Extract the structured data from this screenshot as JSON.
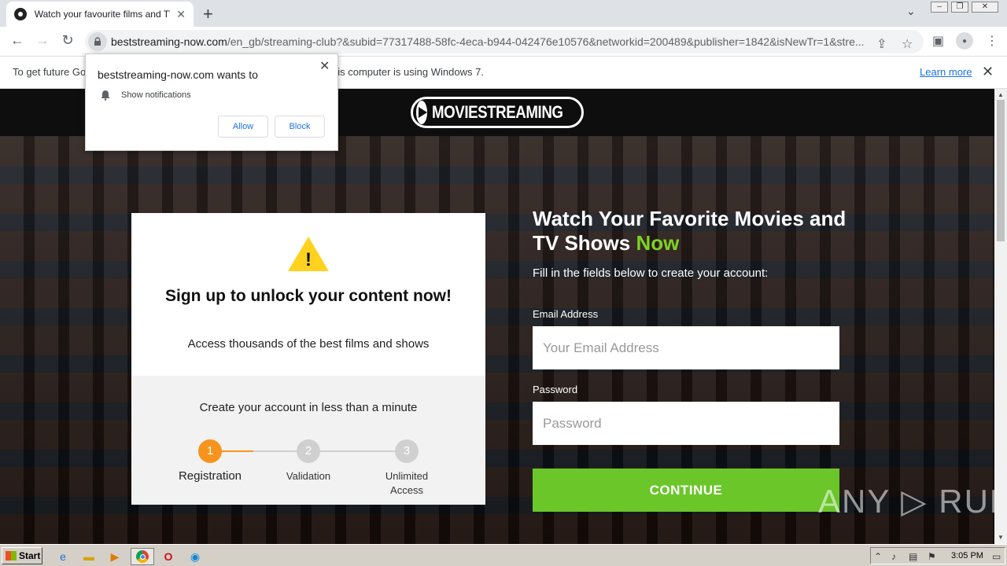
{
  "browser": {
    "tab_title": "Watch your favourite films and TV sh",
    "tab_close": "✕",
    "new_tab": "+",
    "url_host": "beststreaming-now.com",
    "url_path": "/en_gb/streaming-club?&subid=77317488-58fc-4eca-b944-042476e10576&networkid=200489&publisher=1842&isNewTr=1&stre...",
    "back": "←",
    "forward": "→",
    "reload": "↻",
    "share": "⇪",
    "star": "☆",
    "side_panel": "▣",
    "profile": "●",
    "menu": "⋮",
    "tab_dropdown": "⌄"
  },
  "infobar": {
    "text": "To get future Go",
    "text_tail": "is computer is using Windows 7.",
    "learn_more": "Learn more",
    "close": "✕"
  },
  "popup": {
    "title": "beststreaming-now.com wants to",
    "permission": "Show notifications",
    "allow": "Allow",
    "block": "Block",
    "close": "✕"
  },
  "site": {
    "logo_text": "MOVIESTREAMING",
    "card": {
      "warning_glyph": "!",
      "heading": "Sign up to unlock your content now!",
      "subheading": "Access thousands of the best films and shows",
      "bottom_title": "Create your account in less than a minute",
      "steps": [
        {
          "number": "1",
          "label": "Registration",
          "active": true
        },
        {
          "number": "2",
          "label": "Validation",
          "active": false
        },
        {
          "number": "3",
          "label": "Unlimited Access",
          "active": false
        }
      ]
    },
    "form": {
      "heading_main": "Watch Your Favorite Movies and TV Shows ",
      "heading_accent": "Now",
      "subheading": "Fill in the fields below to create your account:",
      "email_label": "Email Address",
      "email_placeholder": "Your Email Address",
      "password_label": "Password",
      "password_placeholder": "Password",
      "continue": "CONTINUE"
    },
    "watermark": "ANY ▷ RUN"
  },
  "taskbar": {
    "start": "Start",
    "clock": "3:05 PM"
  },
  "colors": {
    "accent_green": "#7ed321",
    "button_green": "#6bc62a",
    "step_orange": "#f7941d",
    "step_gray": "#d0d0d0"
  }
}
